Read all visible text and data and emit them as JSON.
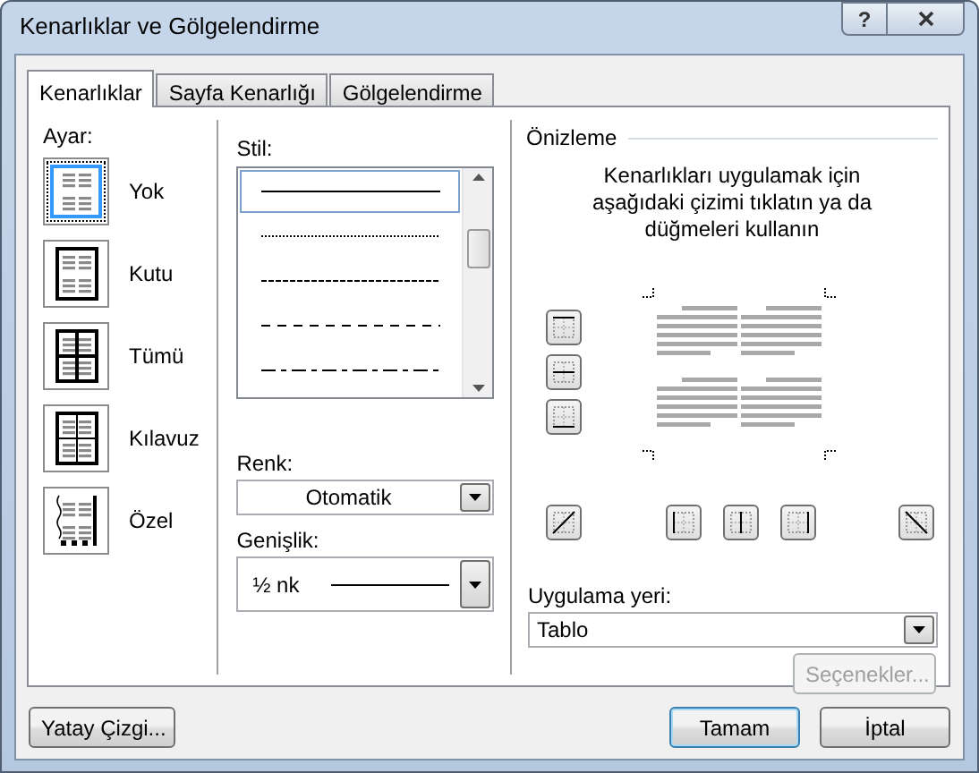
{
  "window": {
    "title": "Kenarlıklar ve Gölgelendirme",
    "help_button": "?"
  },
  "tabs": [
    {
      "label": "Kenarlıklar",
      "selected": true
    },
    {
      "label": "Sayfa Kenarlığı",
      "selected": false
    },
    {
      "label": "Gölgelendirme",
      "selected": false
    }
  ],
  "settings": {
    "label": "Ayar:",
    "items": [
      {
        "label": "Yok",
        "kind": "none",
        "selected": true
      },
      {
        "label": "Kutu",
        "kind": "box",
        "selected": false
      },
      {
        "label": "Tümü",
        "kind": "all",
        "selected": false
      },
      {
        "label": "Kılavuz",
        "kind": "grid",
        "selected": false
      },
      {
        "label": "Özel",
        "kind": "custom",
        "selected": false
      }
    ]
  },
  "style": {
    "label": "Stil:",
    "items": [
      {
        "kind": "solid",
        "selected": true
      },
      {
        "kind": "dotted",
        "selected": false
      },
      {
        "kind": "fine-dash",
        "selected": false
      },
      {
        "kind": "dash",
        "selected": false
      },
      {
        "kind": "dash-dot",
        "selected": false
      }
    ]
  },
  "color": {
    "label": "Renk:",
    "value": "Otomatik"
  },
  "width": {
    "label": "Genişlik:",
    "value": "½ nk"
  },
  "preview": {
    "title": "Önizleme",
    "instructions": "Kenarlıkları uygulamak için aşağıdaki çizimi tıklatın ya da düğmeleri kullanın",
    "side_buttons": [
      {
        "kind": "top"
      },
      {
        "kind": "middle-horizontal"
      },
      {
        "kind": "bottom"
      }
    ],
    "bottom_buttons": [
      {
        "kind": "diagonal-up"
      },
      {
        "kind": "left"
      },
      {
        "kind": "middle-vertical"
      },
      {
        "kind": "right"
      },
      {
        "kind": "diagonal-down"
      }
    ]
  },
  "apply_to": {
    "label": "Uygulama yeri:",
    "value": "Tablo"
  },
  "options_button": {
    "label": "Seçenekler...",
    "disabled": true
  },
  "horizontal_line_button": "Yatay Çizgi...",
  "ok_button": "Tamam",
  "cancel_button": "İptal"
}
